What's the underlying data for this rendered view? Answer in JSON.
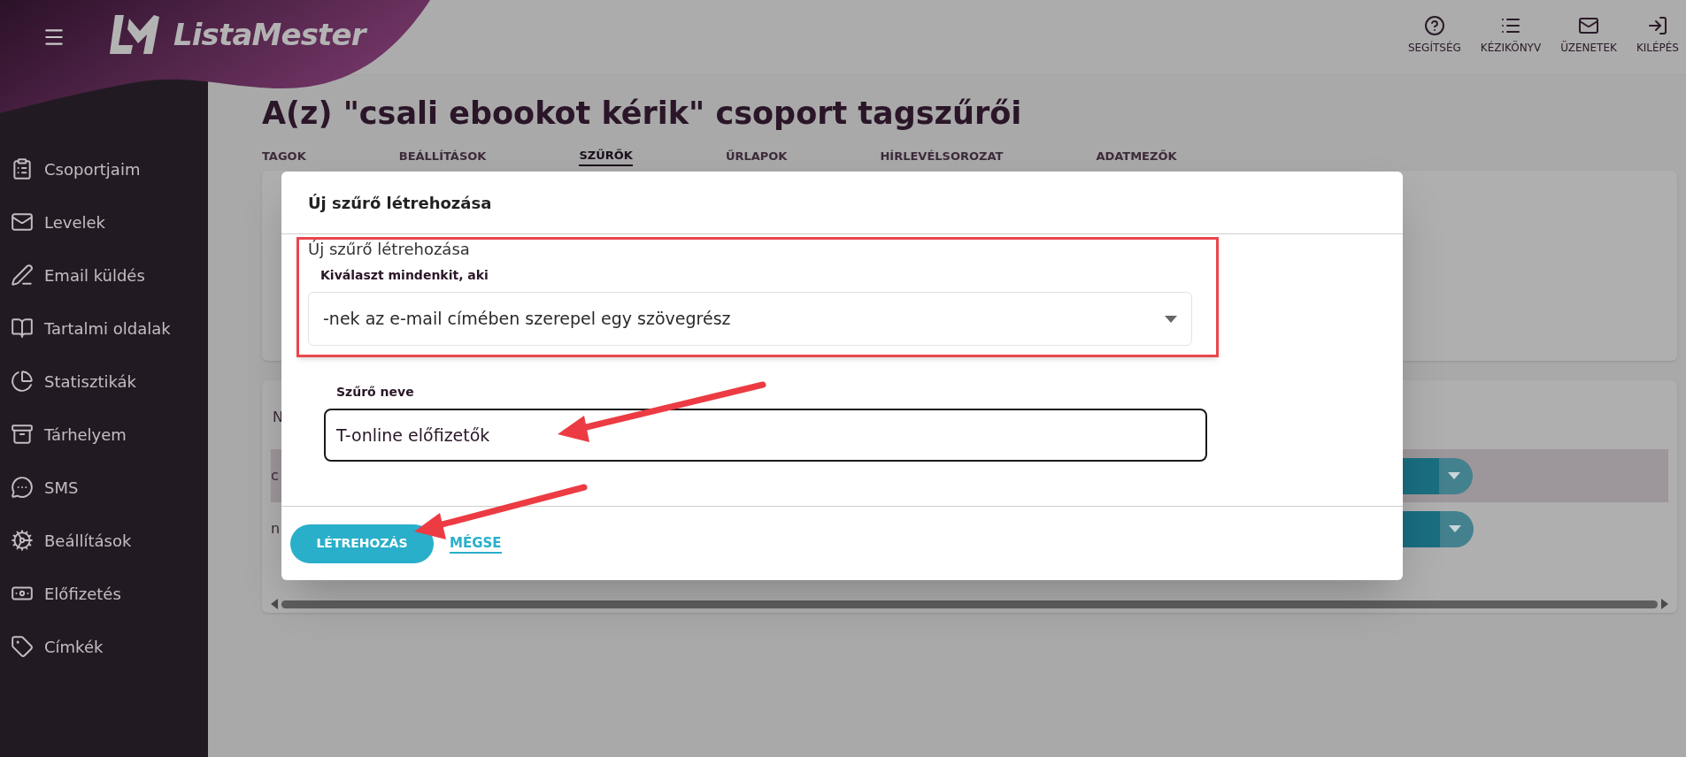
{
  "header": {
    "brand": "ListaMester",
    "links": [
      {
        "label": "SEGÍTSÉG",
        "kind": "help"
      },
      {
        "label": "KÉZIKÖNYV",
        "kind": "manual"
      },
      {
        "label": "ÜZENETEK",
        "kind": "messages"
      },
      {
        "label": "KILÉPÉS",
        "kind": "logout"
      }
    ]
  },
  "sidebar": {
    "items": [
      {
        "label": "Csoportjaim",
        "kind": "groups"
      },
      {
        "label": "Levelek",
        "kind": "letters"
      },
      {
        "label": "Email küldés",
        "kind": "send"
      },
      {
        "label": "Tartalmi oldalak",
        "kind": "pages"
      },
      {
        "label": "Statisztikák",
        "kind": "stats"
      },
      {
        "label": "Tárhelyem",
        "kind": "storage"
      },
      {
        "label": "SMS",
        "kind": "sms"
      },
      {
        "label": "Beállítások",
        "kind": "settings"
      },
      {
        "label": "Előfizetés",
        "kind": "subscription"
      },
      {
        "label": "Címkék",
        "kind": "tags"
      }
    ]
  },
  "page": {
    "title": "A(z) \"csali ebookot kérik\" csoport tagszűrői",
    "tabs": [
      {
        "label": "TAGOK",
        "selected": false
      },
      {
        "label": "BEÁLLÍTÁSOK",
        "selected": false
      },
      {
        "label": "SZŰRŐK",
        "selected": true
      },
      {
        "label": "ŰRLAPOK",
        "selected": false
      },
      {
        "label": "HÍRLEVÉLSOROZAT",
        "selected": false
      },
      {
        "label": "ADATMEZŐK",
        "selected": false
      }
    ]
  },
  "table": {
    "column_1": "N",
    "rows": [
      {
        "cell": "c",
        "selected": true
      },
      {
        "cell": "n",
        "selected": false
      }
    ]
  },
  "dialog": {
    "title": "Új szűrő létrehozása",
    "section_label": "Új szűrő létrehozása",
    "condition": {
      "label": "Kiválaszt mindenkit, aki",
      "value": "-nek az e-mail címében szerepel egy szövegrész"
    },
    "name_field": {
      "label": "Szűrő neve",
      "value": "T-online előfizetők"
    },
    "buttons": [
      {
        "label": "LÉTREHOZÁS",
        "kind": "primary"
      },
      {
        "label": "MÉGSE",
        "kind": "link"
      }
    ]
  }
}
